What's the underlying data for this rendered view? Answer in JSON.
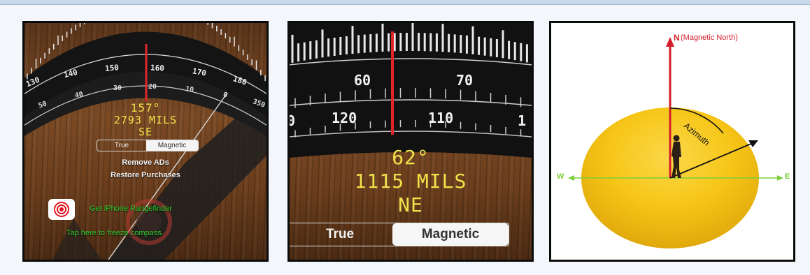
{
  "panel1": {
    "bearing": "157°",
    "mils": "2793 MILS",
    "direction": "SE",
    "toggle_true": "True",
    "toggle_magnetic": "Magnetic",
    "remove_ads": "Remove ADs",
    "restore_purchases": "Restore Purchases",
    "rangefinder_link": "Get iPhone Rangefinder",
    "freeze_hint": "Tap here to freeze compass.",
    "outer_ticks": [
      "130",
      "140",
      "150",
      "160",
      "170",
      "180"
    ],
    "inner_ticks": [
      "50",
      "40",
      "30",
      "20",
      "10",
      "0",
      "350"
    ]
  },
  "panel2": {
    "bearing": "62°",
    "mils": "1115 MILS",
    "direction": "NE",
    "toggle_true": "True",
    "toggle_magnetic": "Magnetic",
    "outer_ticks": [
      "60",
      "70"
    ],
    "inner_ticks": [
      "0",
      "120",
      "110",
      "1"
    ]
  },
  "panel3": {
    "north_label": "N",
    "north_note": "(Magnetic North)",
    "azimuth_label": "Azimuth",
    "west_label": "W",
    "east_label": "E"
  },
  "colors": {
    "lcd_yellow": "#f0e24a",
    "needle_red": "#e1262b",
    "rangefinder_green": "#2fd22f",
    "north_red": "#d31d2a",
    "ew_green": "#7ccf3a",
    "disc_yellow": "#f6c516"
  }
}
